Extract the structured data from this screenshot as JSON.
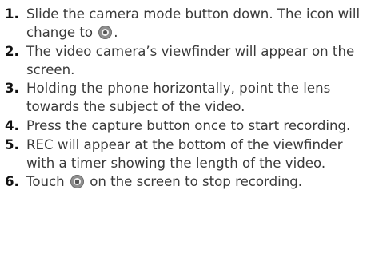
{
  "steps": [
    {
      "number": "1.",
      "text_before": "Slide the camera mode button down. The icon will change to",
      "icon": "video-mode-icon",
      "text_after": "."
    },
    {
      "number": "2.",
      "text": "The video camera’s viewfinder will appear on the screen."
    },
    {
      "number": "3.",
      "text": "Holding the phone horizontally, point the lens towards the subject of the video."
    },
    {
      "number": "4.",
      "text": "Press the capture button once to start recording."
    },
    {
      "number": "5.",
      "text": "REC will appear at the bottom of the viewfinder with a timer showing the length of the video."
    },
    {
      "number": "6.",
      "text_before": "Touch",
      "icon": "stop-record-icon",
      "text_after": "on the screen to stop recording."
    }
  ]
}
